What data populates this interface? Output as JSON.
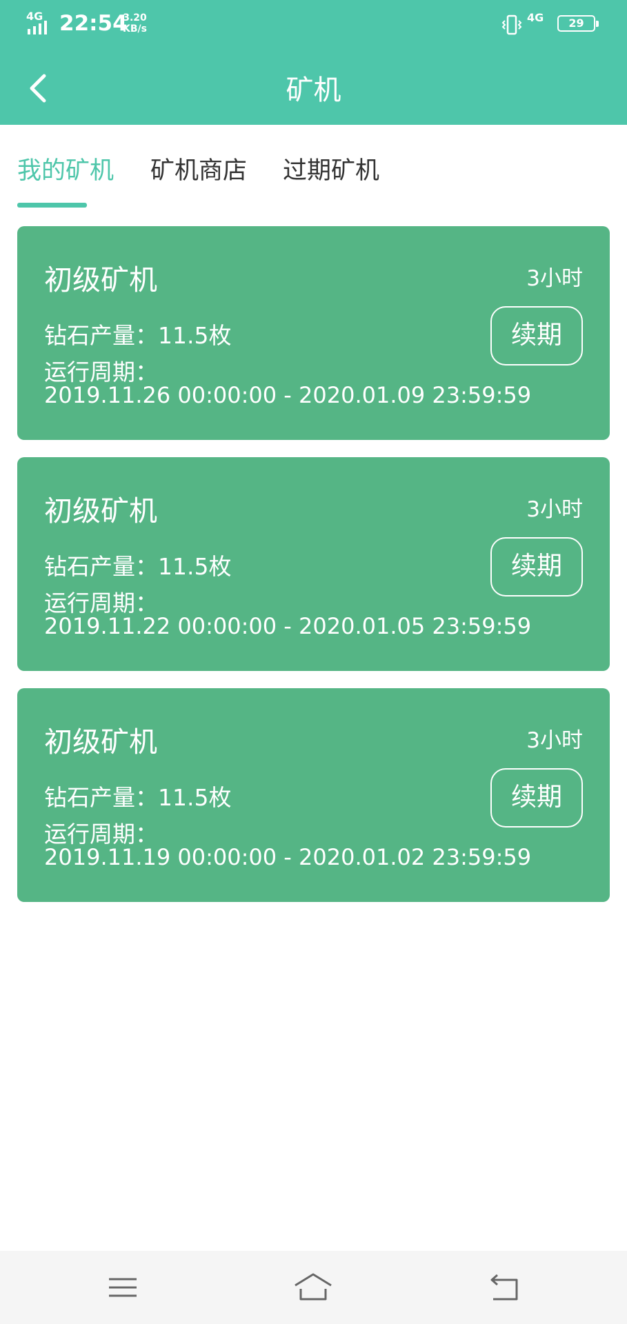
{
  "status_bar": {
    "network": "4G",
    "time": "22:54",
    "speed_value": "3.20",
    "speed_unit": "KB/s",
    "network2": "4G",
    "battery": "29"
  },
  "header": {
    "title": "矿机",
    "back_icon": "chevron-left-icon"
  },
  "tabs": [
    {
      "label": "我的矿机",
      "active": true
    },
    {
      "label": "矿机商店",
      "active": false
    },
    {
      "label": "过期矿机",
      "active": false
    }
  ],
  "cards": [
    {
      "title": "初级矿机",
      "duration": "3小时",
      "output": "钻石产量：11.5枚",
      "period_label": "运行周期：",
      "period": "2019.11.26 00:00:00 - 2020.01.09 23:59:59",
      "renew_label": "续期"
    },
    {
      "title": "初级矿机",
      "duration": "3小时",
      "output": "钻石产量：11.5枚",
      "period_label": "运行周期：",
      "period": "2019.11.22 00:00:00 - 2020.01.05 23:59:59",
      "renew_label": "续期"
    },
    {
      "title": "初级矿机",
      "duration": "3小时",
      "output": "钻石产量：11.5枚",
      "period_label": "运行周期：",
      "period": "2019.11.19 00:00:00 - 2020.01.02 23:59:59",
      "renew_label": "续期"
    }
  ],
  "bottom_nav": {
    "icons": [
      "menu-icon",
      "home-icon",
      "back-icon"
    ]
  },
  "colors": {
    "header": "#4ec6aa",
    "card": "#55b585",
    "active_tab": "#4ec6aa"
  }
}
